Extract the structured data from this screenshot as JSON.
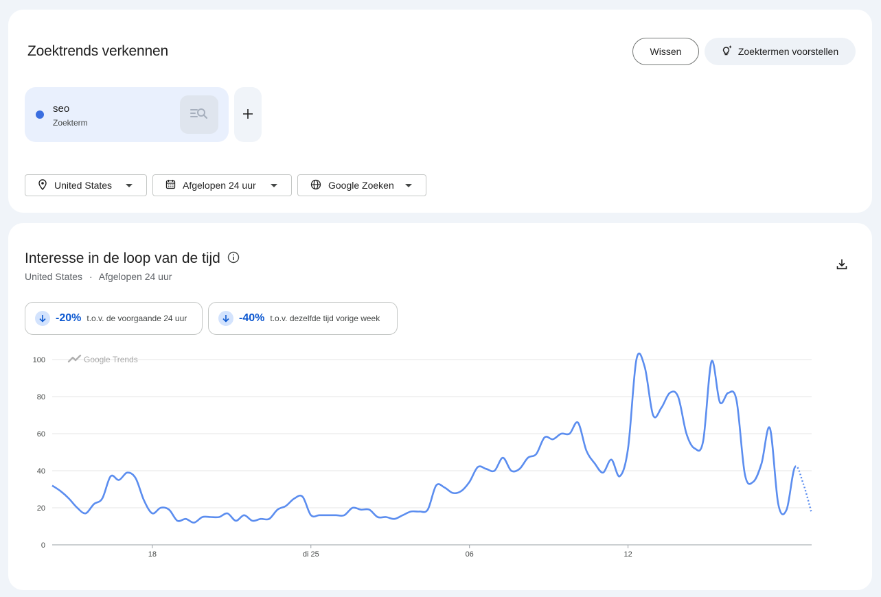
{
  "header": {
    "title": "Zoektrends verkennen",
    "clear_label": "Wissen",
    "suggest_label": "Zoektermen voorstellen"
  },
  "term": {
    "name": "seo",
    "type": "Zoekterm",
    "color": "#3a6ee0"
  },
  "filters": {
    "region": "United States",
    "time": "Afgelopen 24 uur",
    "source": "Google Zoeken"
  },
  "chart_section": {
    "title": "Interesse in de loop van de tijd",
    "subtitle_region": "United States",
    "subtitle_sep": "·",
    "subtitle_time": "Afgelopen 24 uur",
    "watermark": "Google Trends"
  },
  "stats": [
    {
      "value": "-20%",
      "text": "t.o.v. de voorgaande 24 uur"
    },
    {
      "value": "-40%",
      "text": "t.o.v. dezelfde tijd vorige week"
    }
  ],
  "chart_data": {
    "type": "line",
    "title": "",
    "xlabel": "",
    "ylabel": "",
    "ylim": [
      0,
      100
    ],
    "y_ticks": [
      0,
      20,
      40,
      60,
      80,
      100
    ],
    "x_ticks": [
      {
        "label": "18",
        "index": 12
      },
      {
        "label": "di 25",
        "index": 31
      },
      {
        "label": "06",
        "index": 50
      },
      {
        "label": "12",
        "index": 69
      }
    ],
    "grid": true,
    "color": "#5b8def",
    "series": [
      {
        "values": [
          32,
          29,
          25,
          20,
          17,
          22,
          25,
          37,
          35,
          39,
          36,
          24,
          17,
          20,
          19,
          13,
          14,
          12,
          15,
          15,
          15,
          17,
          13,
          16,
          13,
          14,
          14,
          19,
          21,
          25,
          26,
          16,
          16,
          16,
          16,
          16,
          20,
          19,
          19,
          15,
          15,
          14,
          16,
          18,
          18,
          19,
          32,
          31,
          28,
          29,
          34,
          42,
          41,
          40,
          47,
          40,
          41,
          47,
          49,
          58,
          57,
          60,
          60,
          66,
          51,
          44,
          39,
          46,
          37,
          52,
          100,
          96,
          70,
          74,
          82,
          80,
          60,
          52,
          56,
          99,
          77,
          82,
          78,
          38,
          34,
          44,
          63,
          22,
          19,
          42,
          33,
          17
        ],
        "dotted_from_index": 89
      }
    ]
  }
}
